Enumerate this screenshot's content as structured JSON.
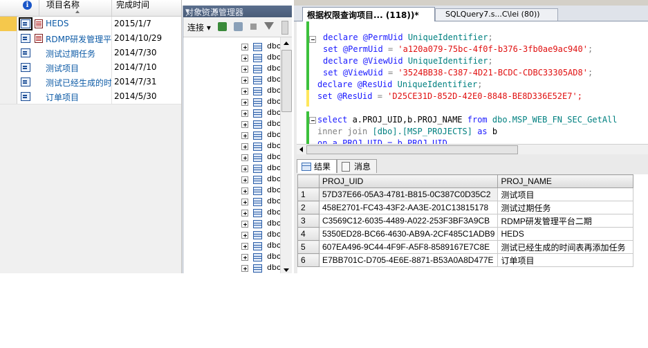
{
  "left_panel": {
    "header": {
      "name_col": "项目名称",
      "date_col": "完成时间",
      "info_icon": "i"
    },
    "rows": [
      {
        "name": "HEDS",
        "date": "2015/1/7"
      },
      {
        "name": "RDMP研发管理平台",
        "date": "2014/10/29"
      },
      {
        "name": "测试过期任务",
        "date": "2014/7/30"
      },
      {
        "name": "测试项目",
        "date": "2014/7/10"
      },
      {
        "name": "测试已经生成的时",
        "date": "2014/7/31"
      },
      {
        "name": "订单项目",
        "date": "2014/5/30"
      }
    ]
  },
  "object_explorer": {
    "title": "对象资源管理器",
    "title_buttons": "▾ ⊣ ✕",
    "connect_label": "连接 ▾",
    "node_label": "dbo"
  },
  "editor": {
    "tab_active": "根据权限查询项目...  (118))*",
    "tab_inactive": "SQLQuery7.s...C\\lei (80))",
    "code": {
      "l1": {
        "kw": "declare",
        "var": " @PermUid",
        "type": " UniqueIdentifier",
        "end": ";"
      },
      "l2": {
        "kw": "set",
        "var": " @PermUid",
        "eq": " = ",
        "str": "'a120a079-75bc-4f0f-b376-3fb0ae9ac940'",
        "end": ";"
      },
      "l3": {
        "kw": "declare",
        "var": " @ViewUid",
        "type": " UniqueIdentifier",
        "end": ";"
      },
      "l4": {
        "kw": "set",
        "var": " @ViewUid",
        "eq": " = ",
        "str": "'3524BB38-C387-4D21-BCDC-CDBC33305AD8'",
        "end": ";"
      },
      "l5": {
        "kw": "declare",
        "var": " @ResUid",
        "type": " UniqueIdentifier",
        "end": ";"
      },
      "l6": {
        "kw": "set",
        "var": " @ResUid",
        "eq": " = ",
        "str": "'D25CE31D-852D-42E0-8848-BE8D336E52E7",
        "end": "';"
      },
      "l7": {
        "kw": "select",
        "rest": " a.PROJ_UID,b.PROJ_NAME ",
        "kw2": "from",
        "obj": " dbo.MSP_WEB_FN_SEC_GetAll"
      },
      "l8": {
        "gray1": "inner join ",
        "obj": "[dbo].[MSP_PROJECTS]",
        "kw": " as",
        "rest": " b"
      },
      "l9": {
        "text": "on a.PROJ_UID = b.PROJ_UID"
      }
    },
    "results_tab": "结果",
    "messages_tab": "消息",
    "grid": {
      "columns": [
        "PROJ_UID",
        "PROJ_NAME"
      ],
      "rows": [
        {
          "n": "1",
          "uid": "57D37E66-05A3-4781-B815-0C387C0D35C2",
          "name": "测试项目"
        },
        {
          "n": "2",
          "uid": "458E2701-FC43-43F2-AA3E-201C13815178",
          "name": "测试过期任务"
        },
        {
          "n": "3",
          "uid": "C3569C12-6035-4489-A022-253F3BF3A9CB",
          "name": "RDMP研发管理平台二期"
        },
        {
          "n": "4",
          "uid": "5350ED28-BC66-4630-AB9A-2CF485C1ADB9",
          "name": "HEDS"
        },
        {
          "n": "5",
          "uid": "607EA496-9C44-4F9F-A5F8-8589167E7C8E",
          "name": "测试已经生成的时间表再添加任务"
        },
        {
          "n": "6",
          "uid": "E7BB701C-D705-4E6E-8871-B53A0A8D477E",
          "name": "订单项目"
        }
      ]
    }
  }
}
